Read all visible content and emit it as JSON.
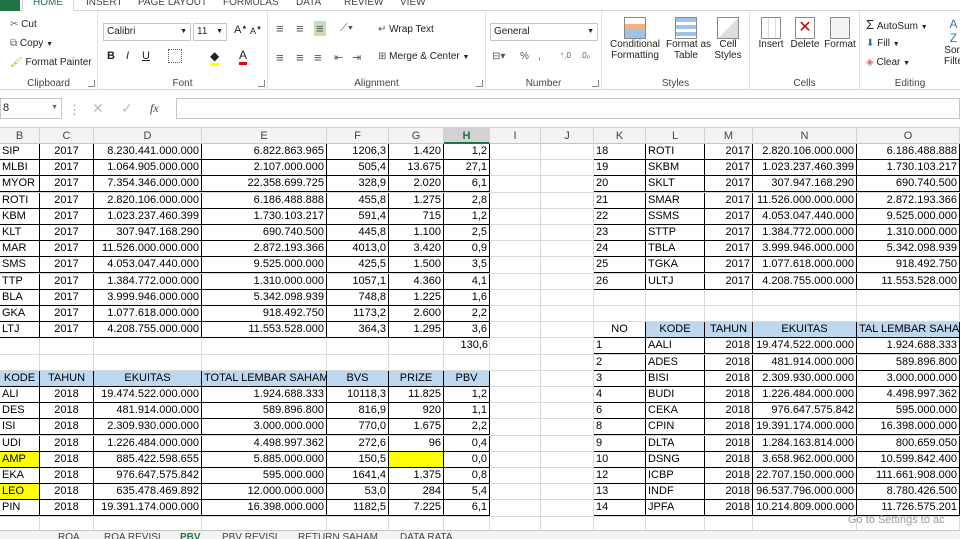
{
  "ribbon_tabs": [
    "HOME",
    "INSERT",
    "PAGE LAYOUT",
    "FORMULAS",
    "DATA",
    "REVIEW",
    "VIEW"
  ],
  "clipboard": {
    "cut": "Cut",
    "copy": "Copy",
    "format_painter": "Format Painter",
    "label": "Clipboard"
  },
  "font": {
    "name": "Calibri",
    "size": "11",
    "label": "Font"
  },
  "alignment": {
    "wrap": "Wrap Text",
    "merge": "Merge & Center",
    "label": "Alignment"
  },
  "number": {
    "format": "General",
    "label": "Number"
  },
  "styles": {
    "cond": [
      "Conditional",
      "Formatting"
    ],
    "fmt_table": [
      "Format as",
      "Table"
    ],
    "cell_styles": [
      "Cell",
      "Styles"
    ],
    "label": "Styles"
  },
  "cells": {
    "insert": "Insert",
    "delete": "Delete",
    "format": "Format",
    "label": "Cells"
  },
  "editing": {
    "autosum": "AutoSum",
    "fill": "Fill",
    "clear": "Clear",
    "sort": [
      "Sort",
      "Filte"
    ],
    "label": "Editing"
  },
  "formula_bar": {
    "name_box": "8",
    "fx": "fx",
    "value": ""
  },
  "columns": [
    "B",
    "C",
    "D",
    "E",
    "F",
    "G",
    "H",
    "I",
    "J",
    "K",
    "L",
    "M",
    "N",
    "O"
  ],
  "selected_column": "H",
  "left_table_2017": [
    [
      "SIP",
      "2017",
      "8.230.441.000.000",
      "6.822.863.965",
      "1206,3",
      "1.420",
      "1,2"
    ],
    [
      "MLBI",
      "2017",
      "1.064.905.000.000",
      "2.107.000.000",
      "505,4",
      "13.675",
      "27,1"
    ],
    [
      "MYOR",
      "2017",
      "7.354.346.000.000",
      "22.358.699.725",
      "328,9",
      "2.020",
      "6,1"
    ],
    [
      "ROTI",
      "2017",
      "2.820.106.000.000",
      "6.186.488.888",
      "455,8",
      "1.275",
      "2,8"
    ],
    [
      "KBM",
      "2017",
      "1.023.237.460.399",
      "1.730.103.217",
      "591,4",
      "715",
      "1,2"
    ],
    [
      "KLT",
      "2017",
      "307.947.168.290",
      "690.740.500",
      "445,8",
      "1.100",
      "2,5"
    ],
    [
      "MAR",
      "2017",
      "11.526.000.000.000",
      "2.872.193.366",
      "4013,0",
      "3.420",
      "0,9"
    ],
    [
      "SMS",
      "2017",
      "4.053.047.440.000",
      "9.525.000.000",
      "425,5",
      "1.500",
      "3,5"
    ],
    [
      "TTP",
      "2017",
      "1.384.772.000.000",
      "1.310.000.000",
      "1057,1",
      "4.360",
      "4,1"
    ],
    [
      "BLA",
      "2017",
      "3.999.946.000.000",
      "5.342.098.939",
      "748,8",
      "1.225",
      "1,6"
    ],
    [
      "GKA",
      "2017",
      "1.077.618.000.000",
      "918.492.750",
      "1173,2",
      "2.600",
      "2,2"
    ],
    [
      "LTJ",
      "2017",
      "4.208.755.000.000",
      "11.553.528.000",
      "364,3",
      "1.295",
      "3,6"
    ]
  ],
  "total_value": "130,6",
  "left_headers_2018": [
    "KODE",
    "TAHUN",
    "EKUITAS",
    "TOTAL LEMBAR SAHAM",
    "BVS",
    "PRIZE",
    "PBV"
  ],
  "left_table_2018": [
    [
      "ALI",
      "2018",
      "19.474.522.000.000",
      "1.924.688.333",
      "10118,3",
      "11.825",
      "1,2"
    ],
    [
      "DES",
      "2018",
      "481.914.000.000",
      "589.896.800",
      "816,9",
      "920",
      "1,1"
    ],
    [
      "ISI",
      "2018",
      "2.309.930.000.000",
      "3.000.000.000",
      "770,0",
      "1.675",
      "2,2"
    ],
    [
      "UDI",
      "2018",
      "1.226.484.000.000",
      "4.498.997.362",
      "272,6",
      "96",
      "0,4"
    ],
    [
      "AMP",
      "2018",
      "885.422.598.655",
      "5.885.000.000",
      "150,5",
      "",
      "0,0"
    ],
    [
      "EKA",
      "2018",
      "976.647.575.842",
      "595.000.000",
      "1641,4",
      "1.375",
      "0,8"
    ],
    [
      "LEO",
      "2018",
      "635.478.469.892",
      "12.000.000.000",
      "53,0",
      "284",
      "5,4"
    ],
    [
      "PIN",
      "2018",
      "19.391.174.000.000",
      "16.398.000.000",
      "1182,5",
      "7.225",
      "6,1"
    ]
  ],
  "right_table_2017": [
    [
      "18",
      "ROTI",
      "2017",
      "2.820.106.000.000",
      "6.186.488.888"
    ],
    [
      "19",
      "SKBM",
      "2017",
      "1.023.237.460.399",
      "1.730.103.217"
    ],
    [
      "20",
      "SKLT",
      "2017",
      "307.947.168.290",
      "690.740.500"
    ],
    [
      "21",
      "SMAR",
      "2017",
      "11.526.000.000.000",
      "2.872.193.366"
    ],
    [
      "22",
      "SSMS",
      "2017",
      "4.053.047.440.000",
      "9.525.000.000"
    ],
    [
      "23",
      "STTP",
      "2017",
      "1.384.772.000.000",
      "1.310.000.000"
    ],
    [
      "24",
      "TBLA",
      "2017",
      "3.999.946.000.000",
      "5.342.098.939"
    ],
    [
      "25",
      "TGKA",
      "2017",
      "1.077.618.000.000",
      "918.492.750"
    ],
    [
      "26",
      "ULTJ",
      "2017",
      "4.208.755.000.000",
      "11.553.528.000"
    ]
  ],
  "right_headers_2018": [
    "NO",
    "KODE",
    "TAHUN",
    "EKUITAS",
    "TAL LEMBAR SAHA"
  ],
  "right_table_2018": [
    [
      "1",
      "AALI",
      "2018",
      "19.474.522.000.000",
      "1.924.688.333"
    ],
    [
      "2",
      "ADES",
      "2018",
      "481.914.000.000",
      "589.896.800"
    ],
    [
      "3",
      "BISI",
      "2018",
      "2.309.930.000.000",
      "3.000.000.000"
    ],
    [
      "4",
      "BUDI",
      "2018",
      "1.226.484.000.000",
      "4.498.997.362"
    ],
    [
      "6",
      "CEKA",
      "2018",
      "976.647.575.842",
      "595.000.000"
    ],
    [
      "8",
      "CPIN",
      "2018",
      "19.391.174.000.000",
      "16.398.000.000"
    ],
    [
      "9",
      "DLTA",
      "2018",
      "1.284.163.814.000",
      "800.659.050"
    ],
    [
      "10",
      "DSNG",
      "2018",
      "3.658.962.000.000",
      "10.599.842.400"
    ],
    [
      "12",
      "ICBP",
      "2018",
      "22.707.150.000.000",
      "111.661.908.000"
    ],
    [
      "13",
      "INDF",
      "2018",
      "96.537.796.000.000",
      "8.780.426.500"
    ],
    [
      "14",
      "JPFA",
      "2018",
      "10.214.809.000.000",
      "11.726.575.201"
    ]
  ],
  "sheet_tabs": [
    "ROA",
    "ROA REVISI",
    "PBV",
    "PBV REVISI",
    "RETURN SAHAM",
    "DATA RATA"
  ],
  "active_sheet": "PBV",
  "watermark": "Go to Settings to ac",
  "colors": {
    "accent": "#217346",
    "header_fill": "#bdd7ee",
    "highlight": "#ffff00"
  }
}
